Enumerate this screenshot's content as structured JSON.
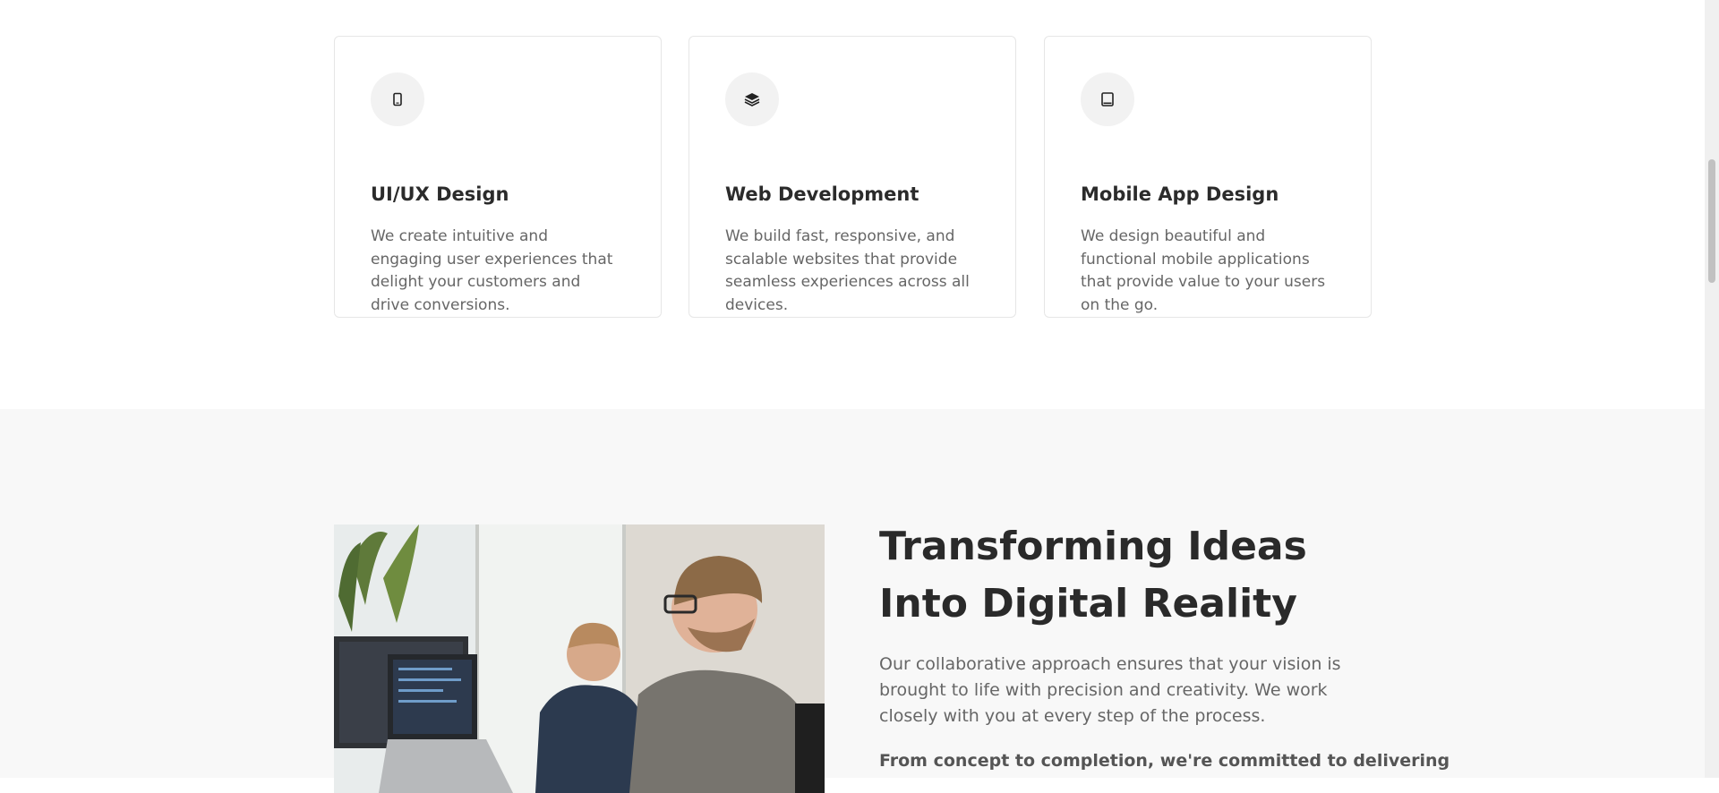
{
  "services": {
    "cards": [
      {
        "icon": "smartphone-icon",
        "title": "UI/UX Design",
        "description": "We create intuitive and engaging user experiences that delight your customers and drive conversions."
      },
      {
        "icon": "layers-icon",
        "title": "Web Development",
        "description": "We build fast, responsive, and scalable websites that provide seamless experiences across all devices."
      },
      {
        "icon": "tablet-icon",
        "title": "Mobile App Design",
        "description": "We design beautiful and functional mobile applications that provide value to your users on the go."
      }
    ]
  },
  "about": {
    "heading": "Transforming Ideas Into Digital Reality",
    "paragraph": "Our collaborative approach ensures that your vision is brought to life with precision and creativity. We work closely with you at every step of the process.",
    "paragraph_bold": "From concept to completion, we're committed to delivering"
  },
  "colors": {
    "heading": "#2a2a2a",
    "body_text": "#666666",
    "section_bg": "#f8f8f8",
    "icon_circle": "#f2f2f2"
  }
}
